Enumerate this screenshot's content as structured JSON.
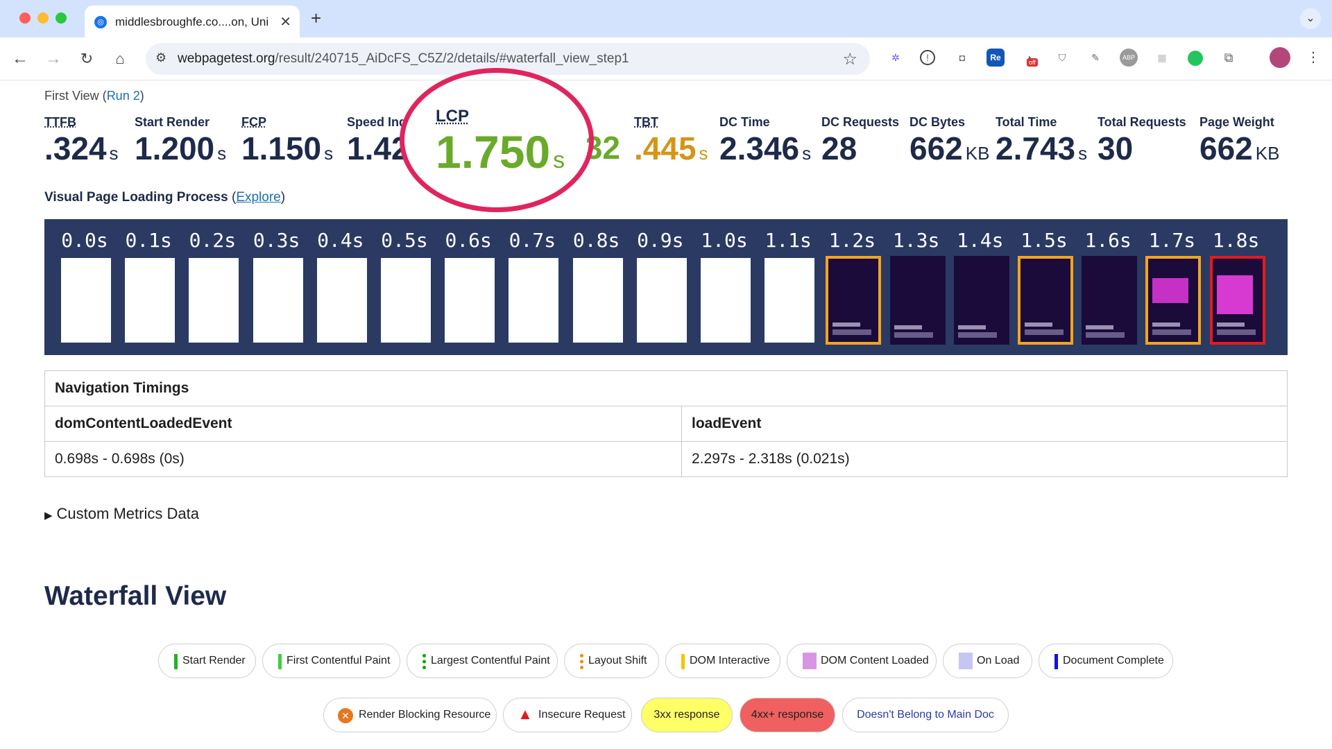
{
  "browser": {
    "tab_title": "middlesbroughfe.co....on, Uni",
    "url_host": "webpagetest.org",
    "url_path": "/result/240715_AiDcFS_C5Z/2/details/#waterfall_view_step1",
    "extension_icons": [
      "puzzle-gear-icon",
      "1password-icon",
      "camera-icon",
      "re-icon",
      "off-icon",
      "shield-icon",
      "pin-icon",
      "abp-icon",
      "grid-icon",
      "green-dot-icon",
      "extensions-icon"
    ],
    "ext_labels": {
      "re": "Re",
      "abp": "ABP",
      "off": "off"
    }
  },
  "first_view": {
    "label": "First View (",
    "run_link": "Run 2",
    "close": ")"
  },
  "metrics": [
    {
      "label": "TTFB",
      "value": ".324",
      "unit": "s"
    },
    {
      "label": "Start Render",
      "value": "1.200",
      "unit": "s"
    },
    {
      "label": "FCP",
      "value": "1.150",
      "unit": "s"
    },
    {
      "label": "Speed Ind",
      "value": "1.42",
      "unit": ""
    },
    {
      "label": "LCP",
      "value": "1.750",
      "unit": "s"
    },
    {
      "label": "",
      "value": "32",
      "unit": ""
    },
    {
      "label": "TBT",
      "value": ".445",
      "unit": "s"
    },
    {
      "label": "DC Time",
      "value": "2.346",
      "unit": "s"
    },
    {
      "label": "DC Requests",
      "value": "28",
      "unit": ""
    },
    {
      "label": "DC Bytes",
      "value": "662",
      "unit": "KB"
    },
    {
      "label": "Total Time",
      "value": "2.743",
      "unit": "s"
    },
    {
      "label": "Total Requests",
      "value": "30",
      "unit": ""
    },
    {
      "label": "Page Weight",
      "value": "662",
      "unit": "KB"
    }
  ],
  "visual_loading": {
    "title": "Visual Page Loading Process",
    "open": " (",
    "explore": "Explore",
    "close": ")"
  },
  "filmstrip": {
    "times": [
      "0.0s",
      "0.1s",
      "0.2s",
      "0.3s",
      "0.4s",
      "0.5s",
      "0.6s",
      "0.7s",
      "0.8s",
      "0.9s",
      "1.0s",
      "1.1s",
      "1.2s",
      "1.3s",
      "1.4s",
      "1.5s",
      "1.6s",
      "1.7s",
      "1.8s"
    ],
    "frame_states": [
      "blank",
      "blank",
      "blank",
      "blank",
      "blank",
      "blank",
      "blank",
      "blank",
      "blank",
      "blank",
      "blank",
      "blank",
      "dark-changed",
      "dark",
      "dark",
      "dark-changed",
      "dark",
      "hero-changed",
      "hero-lcp"
    ],
    "colors": {
      "changed": "#f4a41c",
      "lcp": "#e41b1b",
      "background": "#2a3a63"
    }
  },
  "navigation_timings": {
    "title": "Navigation Timings",
    "headers": [
      "domContentLoadedEvent",
      "loadEvent"
    ],
    "values": [
      "0.698s - 0.698s (0s)",
      "2.297s - 2.318s (0.021s)"
    ]
  },
  "custom_metrics": "Custom Metrics Data",
  "waterfall": {
    "title": "Waterfall View",
    "legend_row1": [
      {
        "label": "Start Render",
        "color": "#22b422"
      },
      {
        "label": "First Contentful Paint",
        "color": "#3bd13b"
      },
      {
        "label": "Largest Contentful Paint",
        "color": "#0a8a0a"
      },
      {
        "label": "Layout Shift",
        "color": "#f48b00"
      },
      {
        "label": "DOM Interactive",
        "color": "#f5c400"
      },
      {
        "label": "DOM Content Loaded",
        "color": "#d896e2"
      },
      {
        "label": "On Load",
        "color": "#c6c6f5"
      },
      {
        "label": "Document Complete",
        "color": "#1010e0"
      }
    ],
    "legend_row2": [
      {
        "label": "Render Blocking Resource",
        "icon": "blocking-x-icon"
      },
      {
        "label": "Insecure Request",
        "icon": "warning-triangle-icon"
      },
      {
        "label": "3xx response",
        "bg": "#ffff66"
      },
      {
        "label": "4xx+ response",
        "bg": "#f06060"
      },
      {
        "label": "Doesn't Belong to Main Doc",
        "fg": "#2b3aa8"
      }
    ]
  }
}
